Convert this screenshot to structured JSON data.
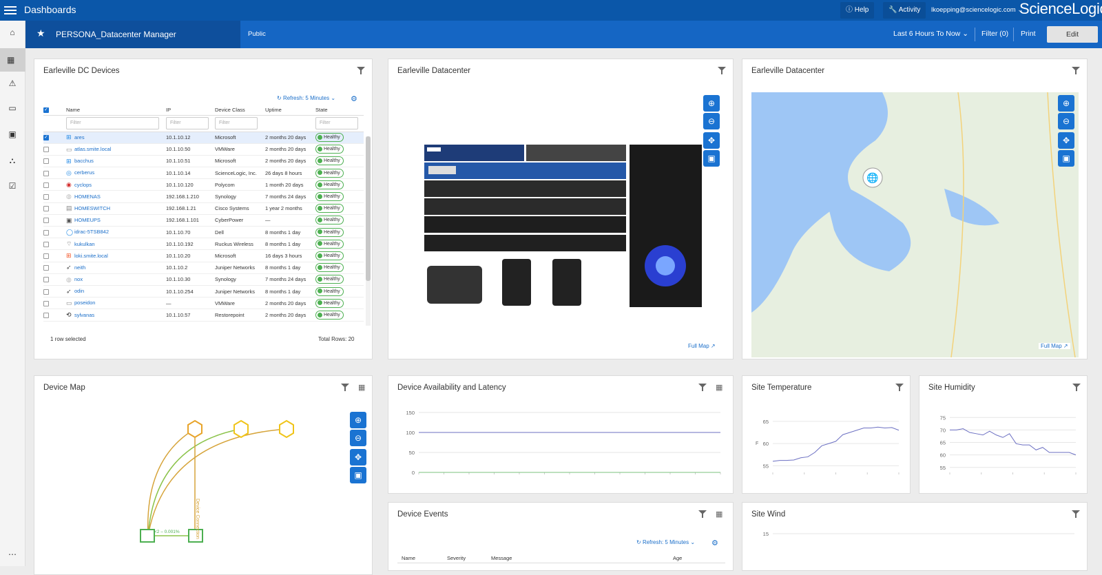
{
  "topbar": {
    "title": "Dashboards",
    "help": "Help",
    "activity": "Activity",
    "user": "lkoepping@sciencelogic.com",
    "logo": "ScienceLogic"
  },
  "subbar": {
    "dashboard_name": "PERSONA_Datacenter Manager",
    "visibility": "Public",
    "timerange": "Last 6 Hours To Now",
    "filter": "Filter (0)",
    "print": "Print",
    "edit": "Edit"
  },
  "devices_panel": {
    "title": "Earleville DC Devices",
    "refresh": "Refresh: 5 Minutes",
    "columns": [
      "Name",
      "IP",
      "Device Class",
      "Uptime",
      "State"
    ],
    "filter_placeholder": "Filter",
    "rows": [
      {
        "name": "ares",
        "ip": "10.1.10.12",
        "class": "Microsoft",
        "uptime": "2 months 20 days",
        "state": "Healthy",
        "selected": true,
        "icon": "windows",
        "color": "#1e88e5"
      },
      {
        "name": "atlas.smite.local",
        "ip": "10.1.10.50",
        "class": "VMWare",
        "uptime": "2 months 20 days",
        "state": "Healthy",
        "icon": "server",
        "color": "#888888"
      },
      {
        "name": "bacchus",
        "ip": "10.1.10.51",
        "class": "Microsoft",
        "uptime": "2 months 20 days",
        "state": "Healthy",
        "icon": "windows",
        "color": "#1e88e5"
      },
      {
        "name": "cerberus",
        "ip": "10.1.10.14",
        "class": "ScienceLogic, Inc.",
        "uptime": "26 days 8 hours",
        "state": "Healthy",
        "icon": "globe",
        "color": "#1e88e5"
      },
      {
        "name": "cyclops",
        "ip": "10.1.10.120",
        "class": "Polycom",
        "uptime": "1 month 20 days",
        "state": "Healthy",
        "icon": "camera",
        "color": "#d32f2f"
      },
      {
        "name": "HOMENAS",
        "ip": "192.168.1.210",
        "class": "Synology",
        "uptime": "7 months 24 days",
        "state": "Healthy",
        "icon": "nas",
        "color": "#bbbbbb"
      },
      {
        "name": "HOMESWITCH",
        "ip": "192.168.1.21",
        "class": "Cisco Systems",
        "uptime": "1 year 2 months",
        "state": "Healthy",
        "icon": "switch",
        "color": "#888888"
      },
      {
        "name": "HOMEUPS",
        "ip": "192.168.1.101",
        "class": "CyberPower",
        "uptime": "—",
        "state": "Healthy",
        "icon": "ups",
        "color": "#555555"
      },
      {
        "name": "idrac-5TSB842",
        "ip": "10.1.10.70",
        "class": "Dell",
        "uptime": "8 months 1 day",
        "state": "Healthy",
        "icon": "dell",
        "color": "#1e88e5"
      },
      {
        "name": "kukulkan",
        "ip": "10.1.10.192",
        "class": "Ruckus Wireless",
        "uptime": "8 months 1 day",
        "state": "Healthy",
        "icon": "wifi",
        "color": "#777777"
      },
      {
        "name": "loki.smite.local",
        "ip": "10.1.10.20",
        "class": "Microsoft",
        "uptime": "16 days 3 hours",
        "state": "Healthy",
        "icon": "windows-color",
        "color": "#f35325"
      },
      {
        "name": "neith",
        "ip": "10.1.10.2",
        "class": "Juniper Networks",
        "uptime": "8 months 1 day",
        "state": "Healthy",
        "icon": "router",
        "color": "#555555"
      },
      {
        "name": "nox",
        "ip": "10.1.10.30",
        "class": "Synology",
        "uptime": "7 months 24 days",
        "state": "Healthy",
        "icon": "nas",
        "color": "#bbbbbb"
      },
      {
        "name": "odin",
        "ip": "10.1.10.254",
        "class": "Juniper Networks",
        "uptime": "8 months 1 day",
        "state": "Healthy",
        "icon": "router",
        "color": "#555555"
      },
      {
        "name": "poseidon",
        "ip": "—",
        "class": "VMWare",
        "uptime": "2 months 20 days",
        "state": "Healthy",
        "icon": "server",
        "color": "#888888"
      },
      {
        "name": "sylvanas",
        "ip": "10.1.10.57",
        "class": "Restorepoint",
        "uptime": "2 months 20 days",
        "state": "Healthy",
        "icon": "restore",
        "color": "#222222"
      }
    ],
    "selected_text": "1 row selected",
    "total_rows": "Total Rows: 20"
  },
  "rack_panel": {
    "title": "Earleville Datacenter",
    "full_map": "Full Map"
  },
  "map_panel": {
    "title": "Earleville Datacenter",
    "full_map": "Full Map"
  },
  "device_map_panel": {
    "title": "Device Map",
    "edge_label": "Device Connection",
    "edge_stat": "<2 – 0.001%"
  },
  "availability_panel": {
    "title": "Device Availability and Latency",
    "chart_data": {
      "type": "line",
      "yticks": [
        150,
        100,
        50,
        0
      ],
      "ylim": [
        0,
        150
      ],
      "series": [
        {
          "values": [
            100,
            100,
            100,
            100,
            100,
            100,
            100,
            100,
            100,
            100,
            100,
            100
          ],
          "color": "#6b6fc2"
        },
        {
          "values": [
            0,
            0,
            0,
            0,
            0,
            0,
            0,
            0,
            0,
            0,
            0,
            0
          ],
          "color": "#7bc17e"
        }
      ]
    }
  },
  "temperature_panel": {
    "title": "Site Temperature",
    "ylabel": "F",
    "chart_data": {
      "type": "line",
      "yticks": [
        65,
        60,
        55
      ],
      "ylim": [
        53.5,
        67
      ],
      "values": [
        56,
        56.2,
        56.2,
        56.3,
        56.8,
        57,
        58,
        59.5,
        60,
        60.5,
        62,
        62.5,
        63,
        63.5,
        63.5,
        63.7,
        63.5,
        63.6,
        63
      ],
      "color": "#6b6fc2"
    }
  },
  "humidity_panel": {
    "title": "Site Humidity",
    "chart_data": {
      "type": "line",
      "yticks": [
        75,
        70,
        65,
        60,
        55
      ],
      "ylim": [
        53,
        77
      ],
      "values": [
        70,
        70,
        70.5,
        69,
        68.5,
        68,
        69.5,
        68,
        67,
        68.5,
        64.5,
        64,
        64,
        62,
        63,
        61,
        61,
        61,
        61,
        60
      ],
      "color": "#6b6fc2"
    }
  },
  "events_panel": {
    "title": "Device Events",
    "refresh": "Refresh: 5 Minutes",
    "columns": [
      "Name",
      "Severity",
      "Message",
      "Age"
    ]
  },
  "wind_panel": {
    "title": "Site Wind",
    "chart_data": {
      "type": "line",
      "yticks": [
        15
      ]
    }
  }
}
